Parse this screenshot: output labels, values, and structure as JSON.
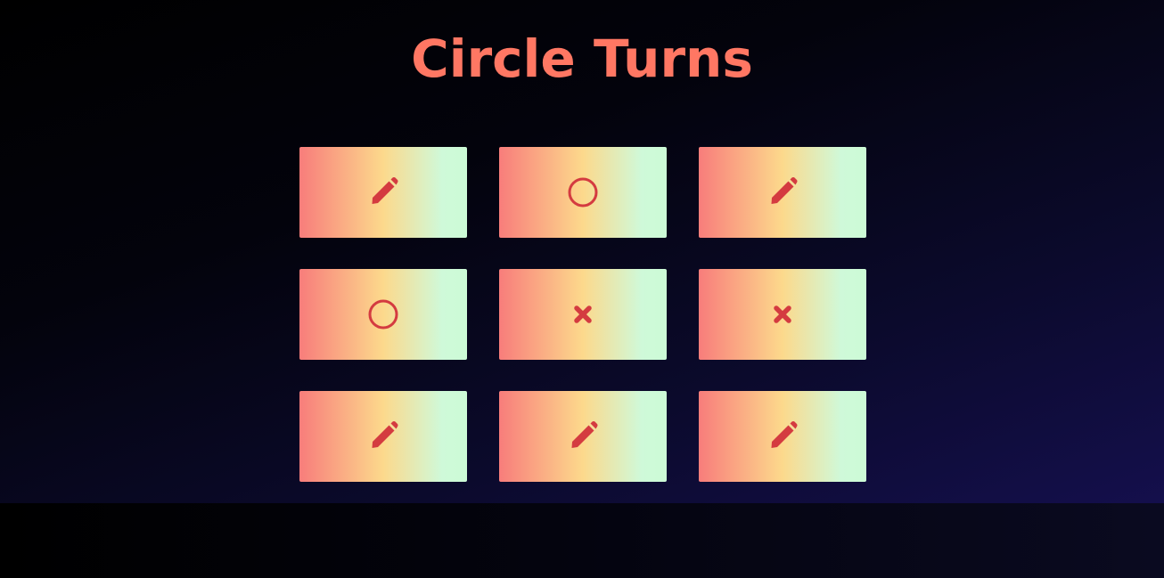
{
  "title": "Circle Turns",
  "colors": {
    "title": "#ff7763",
    "symbol": "#d43b40",
    "cell_gradient": [
      "#f87d7b",
      "#fcd98c",
      "#cff9d9"
    ]
  },
  "board": {
    "cells": [
      {
        "state": "empty",
        "icon": "pencil-icon"
      },
      {
        "state": "O",
        "icon": "circle-icon"
      },
      {
        "state": "empty",
        "icon": "pencil-icon"
      },
      {
        "state": "O",
        "icon": "circle-icon"
      },
      {
        "state": "X",
        "icon": "x-icon"
      },
      {
        "state": "X",
        "icon": "x-icon"
      },
      {
        "state": "empty",
        "icon": "pencil-icon"
      },
      {
        "state": "empty",
        "icon": "pencil-icon"
      },
      {
        "state": "empty",
        "icon": "pencil-icon"
      }
    ]
  }
}
